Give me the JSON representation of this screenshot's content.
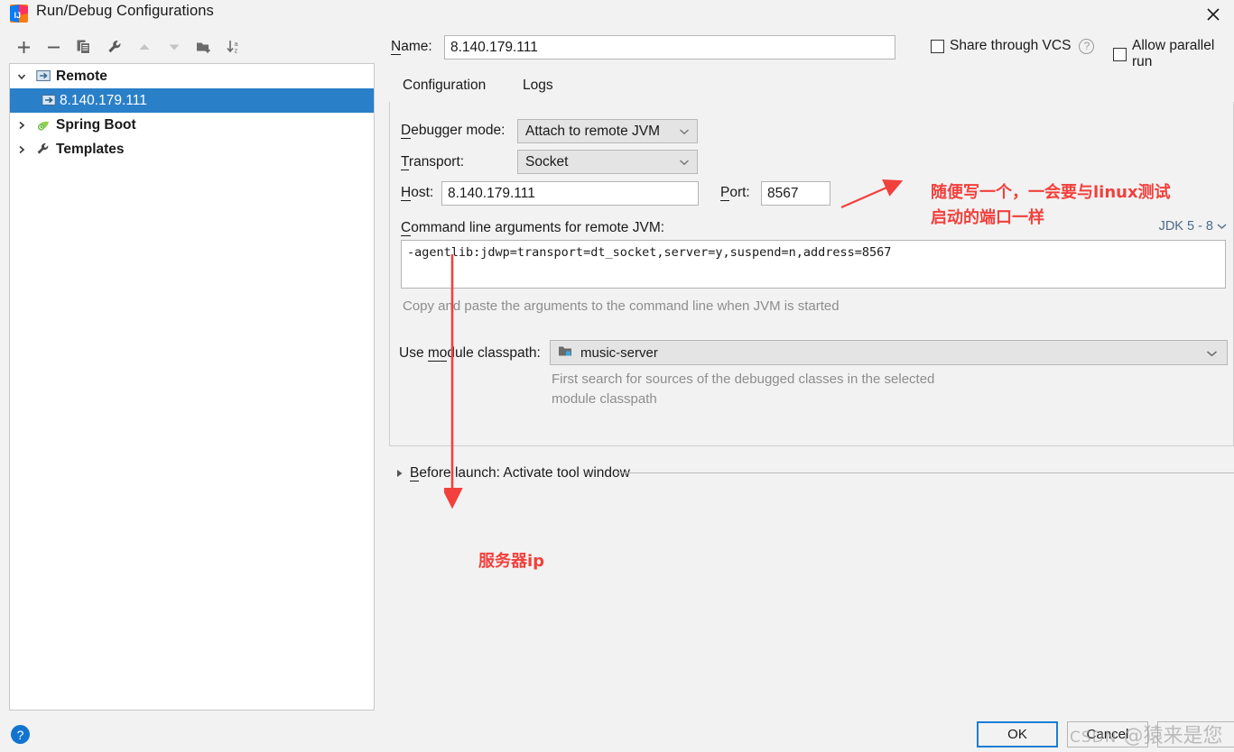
{
  "window": {
    "title": "Run/Debug Configurations",
    "close_icon": "close-icon",
    "app_icon": "intellij-idea-icon"
  },
  "toolbar": {
    "items": [
      {
        "name": "add-configuration-button",
        "icon": "plus-icon",
        "label": "+"
      },
      {
        "name": "remove-configuration-button",
        "icon": "minus-icon",
        "label": "−"
      },
      {
        "name": "copy-configuration-button",
        "icon": "copy-icon",
        "label": "Copy"
      },
      {
        "name": "edit-templates-button",
        "icon": "wrench-icon",
        "label": "Edit Templates"
      },
      {
        "name": "move-up-button",
        "icon": "arrow-up-icon",
        "label": "Move Up"
      },
      {
        "name": "move-down-button",
        "icon": "arrow-down-icon",
        "label": "Move Down"
      },
      {
        "name": "create-folder-button",
        "icon": "folder-add-icon",
        "label": "Create Folder"
      },
      {
        "name": "sort-configurations-button",
        "icon": "sort-az-icon",
        "label": "Sort Configurations"
      }
    ]
  },
  "tree": {
    "nodes": [
      {
        "label": "Remote",
        "icon": "remote-icon",
        "twisty": "chevron-down-icon",
        "selected": false,
        "level": 0
      },
      {
        "label": "8.140.179.111",
        "icon": "remote-icon",
        "twisty": "",
        "selected": true,
        "level": 1
      },
      {
        "label": "Spring Boot",
        "icon": "spring-boot-icon",
        "twisty": "chevron-right-icon",
        "selected": false,
        "level": 0
      },
      {
        "label": "Templates",
        "icon": "wrench-icon",
        "twisty": "chevron-right-icon",
        "selected": false,
        "level": 0
      }
    ]
  },
  "form": {
    "name_label": "Name:",
    "name_value": "8.140.179.111",
    "share_vcs": {
      "label": "Share through VCS",
      "checked": false,
      "help_icon": "question-mark-icon"
    },
    "allow_parallel": {
      "label": "Allow parallel run",
      "checked": false
    },
    "tabs": [
      {
        "label": "Configuration",
        "active": true
      },
      {
        "label": "Logs",
        "active": false
      }
    ],
    "debugger_mode": {
      "label": "Debugger mode:",
      "value": "Attach to remote JVM"
    },
    "transport": {
      "label": "Transport:",
      "value": "Socket"
    },
    "host": {
      "label": "Host:",
      "value": "8.140.179.111"
    },
    "port": {
      "label": "Port:",
      "value": "8567"
    },
    "command_line": {
      "label": "Command line arguments for remote JVM:",
      "value": "-agentlib:jdwp=transport=dt_socket,server=y,suspend=n,address=8567",
      "hint": "Copy and paste the arguments to the command line when JVM is started",
      "jdk_note": "JDK 5 - 8"
    },
    "module_classpath": {
      "label": "Use module classpath:",
      "value": "music-server",
      "icon": "module-folder-icon",
      "hint_line1": "First search for sources of the debugged classes in the selected",
      "hint_line2": "module classpath"
    },
    "before_launch": {
      "label": "Before launch: Activate tool window",
      "expander_icon": "chevron-right-icon"
    }
  },
  "annotations": {
    "port_note_line1": "随便写一个，一会要与linux测试",
    "port_note_line2": "启动的端口一样",
    "host_note": "服务器ip",
    "color": "#f2403c"
  },
  "footer": {
    "help_icon": "question-mark-icon",
    "ok_label": "OK",
    "cancel_label": "Cancel",
    "watermark_csdn": "CSDN",
    "watermark_user": "@猿来是您"
  },
  "colors": {
    "accent": "#2a7fc9",
    "tab_underline": "#3d86c6",
    "annotation_red": "#f2403c",
    "help_blue": "#1374cf",
    "panel_bg": "#f2f2f2"
  }
}
